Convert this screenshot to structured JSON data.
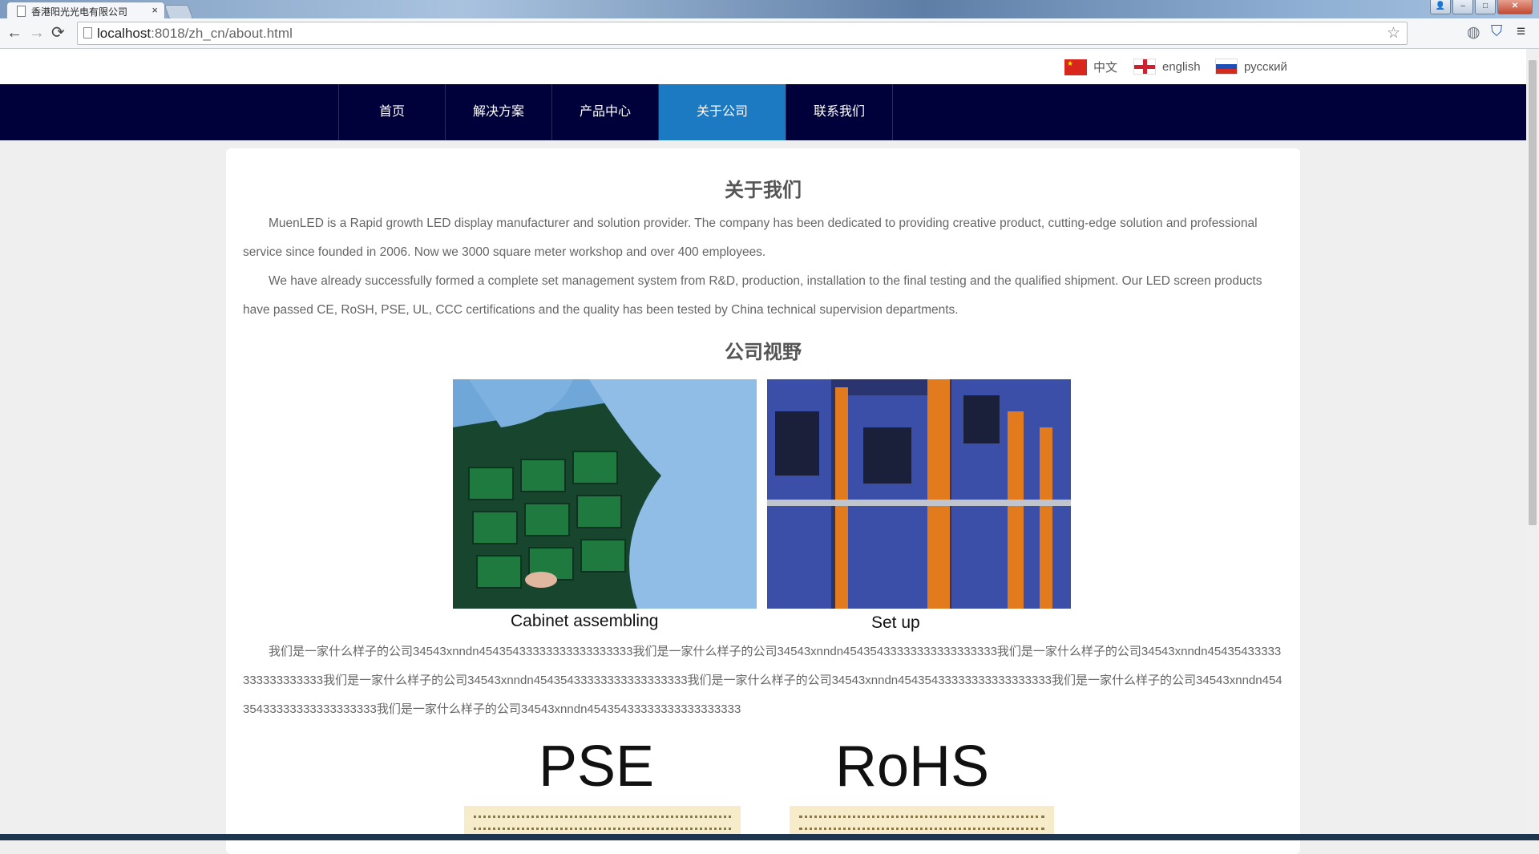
{
  "browser": {
    "tab_title": "香港阳光光电有限公司",
    "tab_close": "×",
    "url_host": "localhost",
    "url_rest": ":8018/zh_cn/about.html"
  },
  "languages": [
    {
      "label": "中文",
      "flag": "cn-flag-icon"
    },
    {
      "label": "english",
      "flag": "en-flag-icon"
    },
    {
      "label": "русский",
      "flag": "ru-flag-icon"
    }
  ],
  "nav": {
    "items": [
      "首页",
      "解决方案",
      "产品中心",
      "关于公司",
      "联系我们"
    ],
    "active_index": 3,
    "bg_color": "#00003a",
    "active_color": "#1b7ac2"
  },
  "about": {
    "title": "关于我们",
    "p1": "MuenLED is a Rapid growth LED display manufacturer and solution provider. The company has been dedicated to providing creative product, cutting-edge solution and professional service since founded in 2006. Now we 3000 square meter workshop and over 400 employees.",
    "p2": "We have already successfully formed a complete set management system from R&D, production, installation to the final testing and the qualified shipment. Our LED screen products have passed CE, RoSH, PSE, UL, CCC certifications and the quality has been tested by China technical supervision departments."
  },
  "vision": {
    "title": "公司视野",
    "caption_left": "Cabinet assembling",
    "caption_right": "Set up",
    "text": "我们是一家什么样子的公司34543xnndn45435433333333333333333我们是一家什么样子的公司34543xnndn45435433333333333333333我们是一家什么样子的公司34543xnndn45435433333333333333333我们是一家什么样子的公司34543xnndn45435433333333333333333我们是一家什么样子的公司34543xnndn45435433333333333333333我们是一家什么样子的公司34543xnndn45435433333333333333333我们是一家什么样子的公司34543xnndn45435433333333333333333"
  },
  "certs": [
    "PSE",
    "RoHS"
  ]
}
